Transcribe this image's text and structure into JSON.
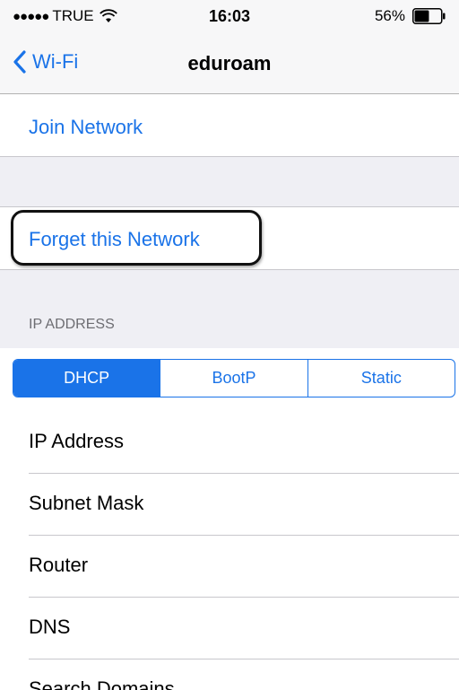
{
  "status_bar": {
    "signal_dots": "●●●●●",
    "carrier": "TRUE",
    "time": "16:03",
    "battery_percent": "56%",
    "battery_level": 0.56
  },
  "nav": {
    "back_label": "Wi-Fi",
    "title": "eduroam"
  },
  "actions": {
    "join_label": "Join Network",
    "forget_label": "Forget this Network"
  },
  "ip_section": {
    "header": "IP ADDRESS",
    "segments": [
      "DHCP",
      "BootP",
      "Static"
    ],
    "selected_segment": "DHCP"
  },
  "fields": [
    {
      "label": "IP Address"
    },
    {
      "label": "Subnet Mask"
    },
    {
      "label": "Router"
    },
    {
      "label": "DNS"
    },
    {
      "label": "Search Domains"
    }
  ],
  "colors": {
    "accent": "#1a73e8",
    "grouped_background": "#efeff4",
    "separator": "#c8c7cc",
    "highlight_outline": "#111111"
  }
}
